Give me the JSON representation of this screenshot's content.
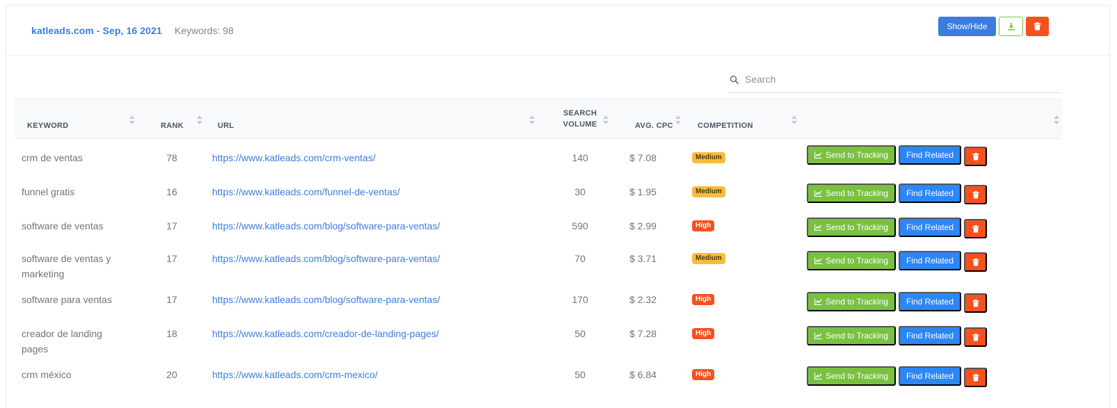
{
  "header": {
    "title": "katleads.com - Sep, 16 2021",
    "keywords_label": "Keywords: 98",
    "showhide_label": "Show/Hide"
  },
  "search": {
    "placeholder": "Search",
    "value": ""
  },
  "columns": {
    "keyword": "KEYWORD",
    "rank": "RANK",
    "url": "URL",
    "volume_line1": "SEARCH",
    "volume_line2": "VOLUME",
    "cpc": "AVG. CPC",
    "competition": "COMPETITION"
  },
  "actions": {
    "track_label": "Send to Tracking",
    "related_label": "Find Related"
  },
  "rows": [
    {
      "keyword": "crm de ventas",
      "rank": "78",
      "url": "https://www.katleads.com/crm-ventas/",
      "volume": "140",
      "cpc": "$ 7.08",
      "competition": "Medium"
    },
    {
      "keyword": "funnel gratis",
      "rank": "16",
      "url": "https://www.katleads.com/funnel-de-ventas/",
      "volume": "30",
      "cpc": "$ 1.95",
      "competition": "Medium"
    },
    {
      "keyword": "software de ventas",
      "rank": "17",
      "url": "https://www.katleads.com/blog/software-para-ventas/",
      "volume": "590",
      "cpc": "$ 2.99",
      "competition": "High"
    },
    {
      "keyword": "software de ventas y marketing",
      "rank": "17",
      "url": "https://www.katleads.com/blog/software-para-ventas/",
      "volume": "70",
      "cpc": "$ 3.71",
      "competition": "Medium"
    },
    {
      "keyword": "software para ventas",
      "rank": "17",
      "url": "https://www.katleads.com/blog/software-para-ventas/",
      "volume": "170",
      "cpc": "$ 2.32",
      "competition": "High"
    },
    {
      "keyword": "creador de landing pages",
      "rank": "18",
      "url": "https://www.katleads.com/creador-de-landing-pages/",
      "volume": "50",
      "cpc": "$ 7.28",
      "competition": "High"
    },
    {
      "keyword": "crm méxico",
      "rank": "20",
      "url": "https://www.katleads.com/crm-mexico/",
      "volume": "50",
      "cpc": "$ 6.84",
      "competition": "High"
    }
  ],
  "colors": {
    "primary": "#3b7ddd",
    "success": "#7ac142",
    "danger": "#f4511e",
    "warning": "#f9bc3a",
    "info_blue": "#2d86f5"
  },
  "icons": {
    "download": "download-icon",
    "trash": "trash-icon",
    "search": "search-icon",
    "chart": "chart-line-icon",
    "sort": "sort-icon"
  }
}
